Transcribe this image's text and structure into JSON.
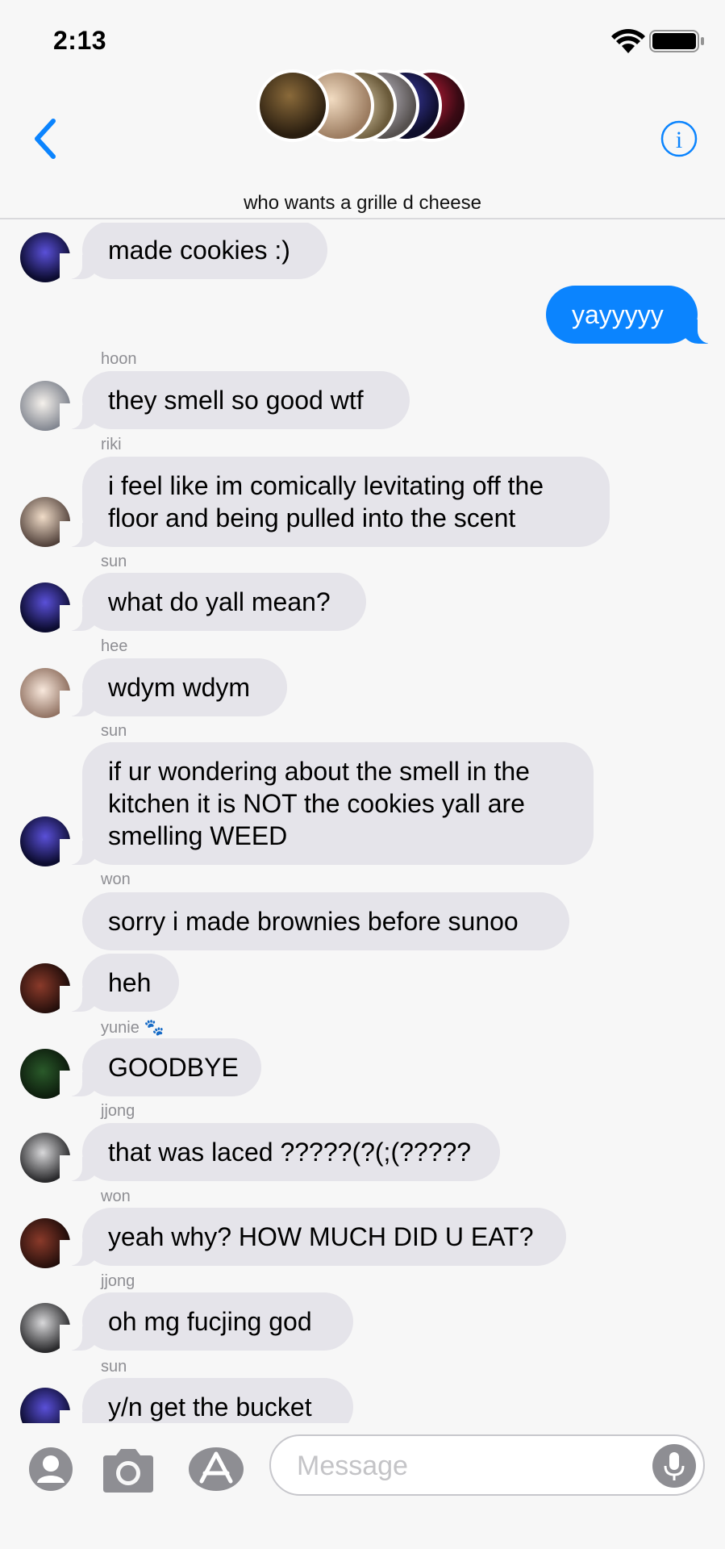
{
  "status_bar": {
    "time": "2:13"
  },
  "header": {
    "group_name": "who wants a grille d cheese"
  },
  "messages": [
    {
      "sender": "",
      "text_lines": [
        "made cookies :)"
      ],
      "outgoing": false
    },
    {
      "sender": "",
      "text_lines": [
        "yayyyyy"
      ],
      "outgoing": true
    },
    {
      "sender": "hoon",
      "text_lines": [
        "they smell so good wtf"
      ],
      "outgoing": false
    },
    {
      "sender": "riki",
      "text_lines": [
        "i feel like im comically levitating off the",
        "floor and being pulled into the scent"
      ],
      "outgoing": false
    },
    {
      "sender": "sun",
      "text_lines": [
        "what do yall mean?"
      ],
      "outgoing": false
    },
    {
      "sender": "hee",
      "text_lines": [
        "wdym wdym"
      ],
      "outgoing": false
    },
    {
      "sender": "sun",
      "text_lines": [
        "if ur wondering about the smell in the",
        "kitchen it is NOT the cookies yall are",
        "smelling WEED"
      ],
      "outgoing": false
    },
    {
      "sender": "won",
      "text_lines": [
        "sorry i made brownies before sunoo"
      ],
      "outgoing": false
    },
    {
      "sender": "",
      "text_lines": [
        "heh"
      ],
      "outgoing": false
    },
    {
      "sender": "yunie",
      "sender_emoji": "🐾",
      "text_lines": [
        "GOODBYE"
      ],
      "outgoing": false
    },
    {
      "sender": "jjong",
      "text_lines": [
        "that was laced ?????(?(;(?????"
      ],
      "outgoing": false
    },
    {
      "sender": "won",
      "text_lines": [
        "yeah why? HOW MUCH DID U EAT?"
      ],
      "outgoing": false
    },
    {
      "sender": "jjong",
      "text_lines": [
        "oh mg fucjing god"
      ],
      "outgoing": false
    },
    {
      "sender": "sun",
      "text_lines": [
        "y/n get the bucket"
      ],
      "outgoing": false
    }
  ],
  "input": {
    "placeholder": "Message"
  },
  "icons": {
    "back": "chevron-left-icon",
    "info": "info-icon",
    "camera": "camera-icon",
    "apps": "app-store-icon",
    "mic": "microphone-icon",
    "contact": "person-icon"
  },
  "colors": {
    "accent": "#0b84fe",
    "incoming_bubble": "#e5e4ea",
    "background": "#f7f7f7"
  }
}
